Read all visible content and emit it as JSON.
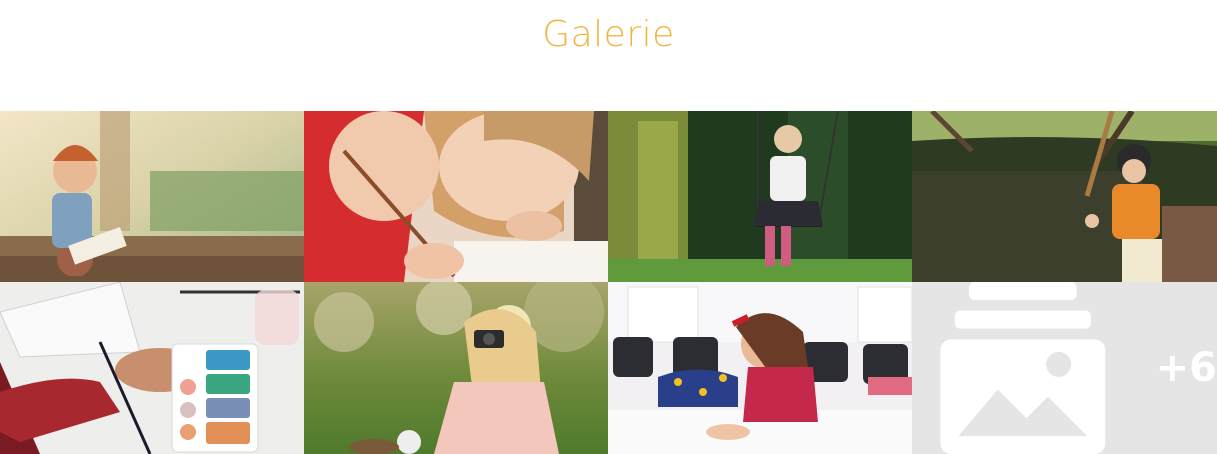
{
  "gallery": {
    "title": "Galerie",
    "photos": [
      {
        "icon": "laughing-boy-with-book-photo"
      },
      {
        "icon": "girl-drawing-photo"
      },
      {
        "icon": "girl-on-swing-photo"
      },
      {
        "icon": "boy-playing-baseball-photo"
      },
      {
        "icon": "watercolor-painting-photo"
      },
      {
        "icon": "girl-with-camera-photo"
      },
      {
        "icon": "girl-writing-at-table-photo"
      }
    ],
    "more": {
      "label": "+6",
      "icon": "image-stack-icon"
    }
  },
  "colors": {
    "title": "#f2b544",
    "more_tile_bg": "#e5e5e6",
    "more_tile_fg": "#ffffff"
  }
}
